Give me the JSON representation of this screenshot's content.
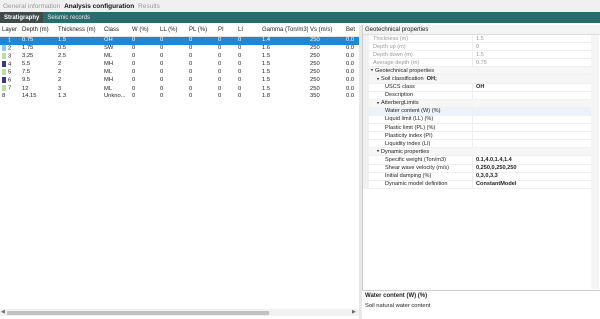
{
  "top_tabs": [
    {
      "label": "General information",
      "active": false
    },
    {
      "label": "Analysis configuration",
      "active": true
    },
    {
      "label": "Results",
      "active": false
    }
  ],
  "sub_tabs": [
    {
      "label": "Stratigraphy",
      "active": true
    },
    {
      "label": "Seismic records",
      "active": false
    }
  ],
  "table": {
    "columns": [
      "Layer",
      "Depth (m)",
      "Thickness (m)",
      "Class",
      "W (%)",
      "LL (%)",
      "PL (%)",
      "PI",
      "LI",
      "Gamma (Ton/m3)",
      "Vs (m/s)",
      "Bet"
    ],
    "rows": [
      {
        "layer": "1",
        "depth": "0.75",
        "thickness": "1.5",
        "class": "OH",
        "w": "0",
        "ll": "0",
        "pl": "0",
        "pi": "0",
        "li": "0",
        "gamma": "1.4",
        "vs": "250",
        "bet": "0.0",
        "swatch": "#1e88d6",
        "selected": true
      },
      {
        "layer": "2",
        "depth": "1.75",
        "thickness": "0.5",
        "class": "SW",
        "w": "0",
        "ll": "0",
        "pl": "0",
        "pi": "0",
        "li": "0",
        "gamma": "1.6",
        "vs": "250",
        "bet": "0.0",
        "swatch": "#8cc8e8",
        "selected": false
      },
      {
        "layer": "3",
        "depth": "3.25",
        "thickness": "2.5",
        "class": "ML",
        "w": "0",
        "ll": "0",
        "pl": "0",
        "pi": "0",
        "li": "0",
        "gamma": "1.5",
        "vs": "250",
        "bet": "0.0",
        "swatch": "#b8e0a0",
        "selected": false
      },
      {
        "layer": "4",
        "depth": "5.5",
        "thickness": "2",
        "class": "MH",
        "w": "0",
        "ll": "0",
        "pl": "0",
        "pi": "0",
        "li": "0",
        "gamma": "1.5",
        "vs": "250",
        "bet": "0.0",
        "swatch": "#3a3a8c",
        "selected": false
      },
      {
        "layer": "5",
        "depth": "7.5",
        "thickness": "2",
        "class": "ML",
        "w": "0",
        "ll": "0",
        "pl": "0",
        "pi": "0",
        "li": "0",
        "gamma": "1.5",
        "vs": "250",
        "bet": "0.0",
        "swatch": "#b8e0a0",
        "selected": false
      },
      {
        "layer": "6",
        "depth": "9.5",
        "thickness": "2",
        "class": "MH",
        "w": "0",
        "ll": "0",
        "pl": "0",
        "pi": "0",
        "li": "0",
        "gamma": "1.5",
        "vs": "250",
        "bet": "0.0",
        "swatch": "#3a3a8c",
        "selected": false
      },
      {
        "layer": "7",
        "depth": "12",
        "thickness": "3",
        "class": "ML",
        "w": "0",
        "ll": "0",
        "pl": "0",
        "pi": "0",
        "li": "0",
        "gamma": "1.5",
        "vs": "250",
        "bet": "0.0",
        "swatch": "#b8e0a0",
        "selected": false
      },
      {
        "layer": "8",
        "depth": "14.15",
        "thickness": "1.3",
        "class": "Unkno...",
        "w": "0",
        "ll": "0",
        "pl": "0",
        "pi": "0",
        "li": "0",
        "gamma": "1.8",
        "vs": "350",
        "bet": "0.0",
        "swatch": "",
        "selected": false
      }
    ]
  },
  "properties": {
    "header": "Geotechnical properties",
    "rows": [
      {
        "kind": "prop",
        "indent": 0,
        "name": "Thickness (m)",
        "value": "1.5",
        "disabled": true
      },
      {
        "kind": "prop",
        "indent": 0,
        "name": "Depth up (m)",
        "value": "0",
        "disabled": true
      },
      {
        "kind": "prop",
        "indent": 0,
        "name": "Depth down (m)",
        "value": "1.5",
        "disabled": true
      },
      {
        "kind": "prop",
        "indent": 0,
        "name": "Average depth (m)",
        "value": "0.75",
        "disabled": true
      },
      {
        "kind": "category",
        "indent": 0,
        "name": "Geotechnical properties",
        "value": ""
      },
      {
        "kind": "category",
        "indent": 1,
        "name": "Soil classification",
        "value": "OH;",
        "bold": true
      },
      {
        "kind": "prop",
        "indent": 2,
        "name": "USCS class",
        "value": "OH",
        "bold": true
      },
      {
        "kind": "prop",
        "indent": 2,
        "name": "Description",
        "value": ""
      },
      {
        "kind": "category",
        "indent": 1,
        "name": "AtterbergLimits",
        "value": ""
      },
      {
        "kind": "prop",
        "indent": 2,
        "name": "Water content (W) (%)",
        "value": "",
        "focused": true
      },
      {
        "kind": "prop",
        "indent": 2,
        "name": "Liquid limit (LL) (%)",
        "value": ""
      },
      {
        "kind": "prop",
        "indent": 2,
        "name": "Plastic limit (PL) (%)",
        "value": ""
      },
      {
        "kind": "prop",
        "indent": 2,
        "name": "Plasticity index (PI)",
        "value": ""
      },
      {
        "kind": "prop",
        "indent": 2,
        "name": "Liquidity index (LI)",
        "value": ""
      },
      {
        "kind": "category",
        "indent": 1,
        "name": "Dynamic properties",
        "value": ""
      },
      {
        "kind": "prop",
        "indent": 2,
        "name": "Specific weight (Ton/m3)",
        "value": "0.1,4.0,1.4,1.4",
        "bold": true
      },
      {
        "kind": "prop",
        "indent": 2,
        "name": "Shear wave velocity (m/s)",
        "value": "0,250,0,250,250",
        "bold": true
      },
      {
        "kind": "prop",
        "indent": 2,
        "name": "Initial damping (%)",
        "value": "0,3,0,3,3",
        "bold": true
      },
      {
        "kind": "prop",
        "indent": 2,
        "name": "Dynamic model definition",
        "value": "ConstantModel",
        "bold": true
      }
    ]
  },
  "description": {
    "title": "Water content (W) (%)",
    "text": "Soil natural water content"
  },
  "icons": {
    "expanded": "chevron-down-icon",
    "scroll_left": "arrow-left-icon",
    "scroll_right": "arrow-right-icon"
  }
}
